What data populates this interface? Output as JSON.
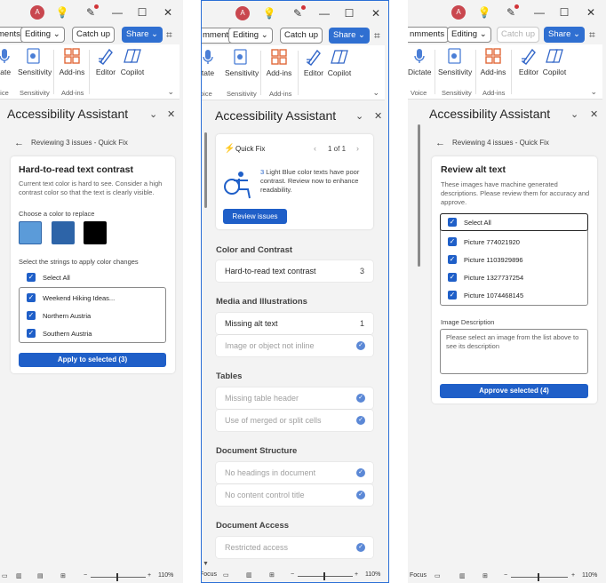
{
  "window": {
    "avatar_initial": "A",
    "minimize": "—",
    "maximize": "☐",
    "close": "✕"
  },
  "commands": {
    "comments_p1": "ments",
    "comments_p2": "mments",
    "comments_p3": "nmments",
    "editing": "Editing",
    "catch_up": "Catch up",
    "share": "Share"
  },
  "ribbon": {
    "dictate": "Dictate",
    "state_partial": "tate",
    "sensitivity": "Sensitivity",
    "addins": "Add-ins",
    "editor": "Editor",
    "copilot": "Copilot",
    "group_voice": "Voice",
    "group_voice_partial": "oice",
    "group_sensitivity": "Sensitivity",
    "group_addins": "Add-ins"
  },
  "pane": {
    "title": "Accessibility Assistant"
  },
  "panel1": {
    "back_label": "Reviewing 3 issues - Quick Fix",
    "card_title": "Hard-to-read text contrast",
    "card_desc": "Current text color is hard to see. Consider a high contrast color so that the text is clearly visible.",
    "choose_color": "Choose a color to replace",
    "swatches": [
      "#5b9bd9",
      "#2d64a8",
      "#000000"
    ],
    "select_strings": "Select the strings to apply color changes",
    "select_all": "Select All",
    "strings": [
      "Weekend Hiking Ideas...",
      "Northern Austria",
      "Southern Austria"
    ],
    "apply_button": "Apply to selected (3)"
  },
  "panel2": {
    "quick_fix": "Quick Fix",
    "pager": "1 of 1",
    "qf_count": "3",
    "qf_text": " Light Blue color texts have poor contrast. Review now to enhance readability.",
    "review_button": "Review issues",
    "sections": [
      {
        "title": "Color and Contrast",
        "items": [
          {
            "label": "Hard-to-read text contrast",
            "count": "3"
          }
        ]
      },
      {
        "title": "Media and Illustrations",
        "items": [
          {
            "label": "Missing alt text",
            "count": "1"
          },
          {
            "label": "Image or object not inline",
            "count": ""
          }
        ]
      },
      {
        "title": "Tables",
        "items": [
          {
            "label": "Missing table header",
            "count": ""
          },
          {
            "label": "Use of merged or split cells",
            "count": ""
          }
        ]
      },
      {
        "title": "Document Structure",
        "items": [
          {
            "label": "No headings in document",
            "count": ""
          },
          {
            "label": "No content control title",
            "count": ""
          }
        ]
      },
      {
        "title": "Document Access",
        "items": [
          {
            "label": "Restricted access",
            "count": ""
          }
        ]
      }
    ]
  },
  "panel3": {
    "back_label": "Reviewing 4 issues - Quick Fix",
    "card_title": "Review alt text",
    "card_desc": "These images have machine generated descriptions. Please review them for accuracy and approve.",
    "select_all": "Select All",
    "pictures": [
      "Picture 774021920",
      "Picture 1103929896",
      "Picture 1327737254",
      "Picture 1074468145"
    ],
    "image_desc_label": "Image Description",
    "image_desc_placeholder": "Please select an image from the list above to see its description",
    "approve_button": "Approve selected (4)"
  },
  "status": {
    "focus": "Focus",
    "zoom": "110%",
    "minus": "−",
    "plus": "+"
  }
}
